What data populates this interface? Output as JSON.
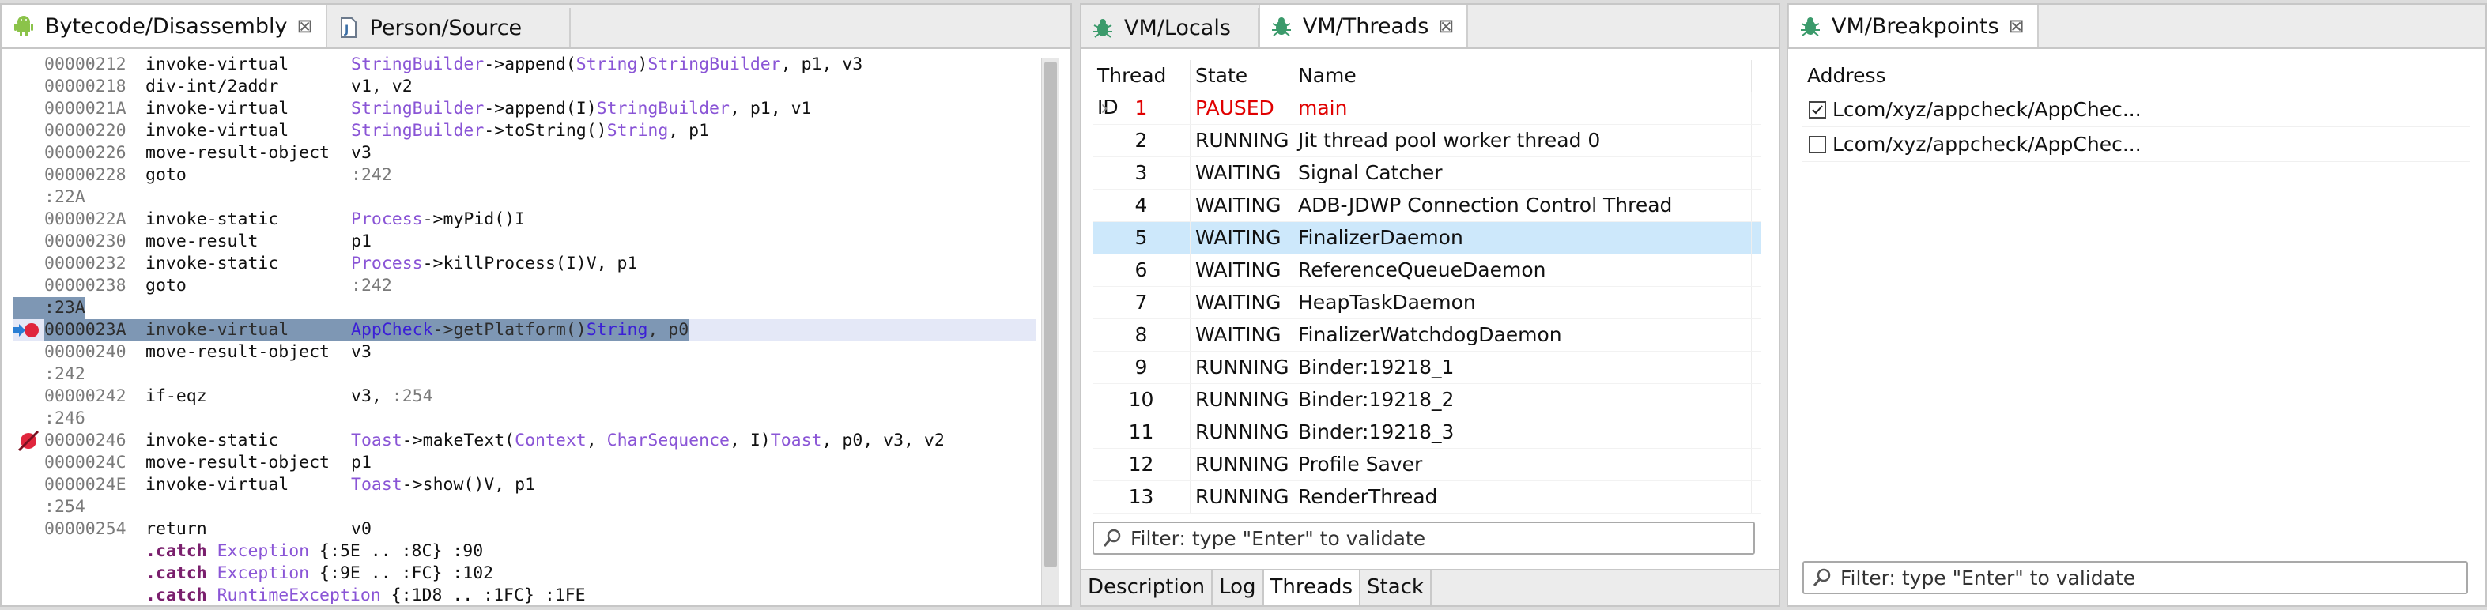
{
  "left_panel": {
    "tabs": [
      {
        "label": "Bytecode/Disassembly",
        "active": true
      },
      {
        "label": "Person/Source",
        "active": false
      }
    ],
    "code_lines": [
      {
        "type": "ins",
        "addr": "00000212",
        "op": "invoke-virtual",
        "args": [
          {
            "t": "StringBuilder",
            "c": "cls"
          },
          {
            "t": "->append(",
            "c": ""
          },
          {
            "t": "String",
            "c": "cls"
          },
          {
            "t": ")",
            "c": ""
          },
          {
            "t": "StringBuilder",
            "c": "cls"
          },
          {
            "t": ", p1, v3",
            "c": ""
          }
        ]
      },
      {
        "type": "ins",
        "addr": "00000218",
        "op": "div-int/2addr",
        "args": [
          {
            "t": "v1, v2",
            "c": ""
          }
        ]
      },
      {
        "type": "ins",
        "addr": "0000021A",
        "op": "invoke-virtual",
        "args": [
          {
            "t": "StringBuilder",
            "c": "cls"
          },
          {
            "t": "->append(I)",
            "c": ""
          },
          {
            "t": "StringBuilder",
            "c": "cls"
          },
          {
            "t": ", p1, v1",
            "c": ""
          }
        ]
      },
      {
        "type": "ins",
        "addr": "00000220",
        "op": "invoke-virtual",
        "args": [
          {
            "t": "StringBuilder",
            "c": "cls"
          },
          {
            "t": "->toString()",
            "c": ""
          },
          {
            "t": "String",
            "c": "cls"
          },
          {
            "t": ", p1",
            "c": ""
          }
        ]
      },
      {
        "type": "ins",
        "addr": "00000226",
        "op": "move-result-object",
        "args": [
          {
            "t": "v3",
            "c": ""
          }
        ]
      },
      {
        "type": "ins",
        "addr": "00000228",
        "op": "goto",
        "args": [
          {
            "t": ":242",
            "c": "dim"
          }
        ]
      },
      {
        "type": "label",
        "text": ":22A"
      },
      {
        "type": "ins",
        "addr": "0000022A",
        "op": "invoke-static",
        "args": [
          {
            "t": "Process",
            "c": "cls"
          },
          {
            "t": "->myPid()I",
            "c": ""
          }
        ]
      },
      {
        "type": "ins",
        "addr": "00000230",
        "op": "move-result",
        "args": [
          {
            "t": "p1",
            "c": ""
          }
        ]
      },
      {
        "type": "ins",
        "addr": "00000232",
        "op": "invoke-static",
        "args": [
          {
            "t": "Process",
            "c": "cls"
          },
          {
            "t": "->killProcess(I)V, p1",
            "c": ""
          }
        ]
      },
      {
        "type": "ins",
        "addr": "00000238",
        "op": "goto",
        "args": [
          {
            "t": ":242",
            "c": "dim"
          }
        ]
      },
      {
        "type": "label",
        "text": ":23A",
        "selected": true,
        "gutter": "arrow"
      },
      {
        "type": "ins",
        "addr": "0000023A",
        "op": "invoke-virtual",
        "highlight": true,
        "selected": true,
        "gutter": "breakpoint-arrow",
        "args": [
          {
            "t": "AppCheck",
            "c": "cls"
          },
          {
            "t": "->getPlatform()",
            "c": ""
          },
          {
            "t": "String",
            "c": "cls"
          },
          {
            "t": ", p0",
            "c": ""
          }
        ]
      },
      {
        "type": "ins",
        "addr": "00000240",
        "op": "move-result-object",
        "args": [
          {
            "t": "v3",
            "c": ""
          }
        ]
      },
      {
        "type": "label",
        "text": ":242"
      },
      {
        "type": "ins",
        "addr": "00000242",
        "op": "if-eqz",
        "args": [
          {
            "t": "v3, ",
            "c": ""
          },
          {
            "t": ":254",
            "c": "dim"
          }
        ]
      },
      {
        "type": "label",
        "text": ":246"
      },
      {
        "type": "ins",
        "addr": "00000246",
        "op": "invoke-static",
        "gutter": "breakpoint-disabled",
        "args": [
          {
            "t": "Toast",
            "c": "cls"
          },
          {
            "t": "->makeText(",
            "c": ""
          },
          {
            "t": "Context",
            "c": "cls"
          },
          {
            "t": ", ",
            "c": ""
          },
          {
            "t": "CharSequence",
            "c": "cls"
          },
          {
            "t": ", I)",
            "c": ""
          },
          {
            "t": "Toast",
            "c": "cls"
          },
          {
            "t": ", p0, v3, v2",
            "c": ""
          }
        ]
      },
      {
        "type": "ins",
        "addr": "0000024C",
        "op": "move-result-object",
        "args": [
          {
            "t": "p1",
            "c": ""
          }
        ]
      },
      {
        "type": "ins",
        "addr": "0000024E",
        "op": "invoke-virtual",
        "args": [
          {
            "t": "Toast",
            "c": "cls"
          },
          {
            "t": "->show()V, p1",
            "c": ""
          }
        ]
      },
      {
        "type": "label",
        "text": ":254"
      },
      {
        "type": "ins",
        "addr": "00000254",
        "op": "return",
        "args": [
          {
            "t": "v0",
            "c": ""
          }
        ]
      },
      {
        "type": "catch",
        "parts": [
          {
            "t": ".catch ",
            "c": "kw"
          },
          {
            "t": "Exception",
            "c": "cls"
          },
          {
            "t": " {:5E .. :8C} :90",
            "c": ""
          }
        ]
      },
      {
        "type": "catch",
        "parts": [
          {
            "t": ".catch ",
            "c": "kw"
          },
          {
            "t": "Exception",
            "c": "cls"
          },
          {
            "t": " {:9E .. :FC} :102",
            "c": ""
          }
        ]
      },
      {
        "type": "catch",
        "parts": [
          {
            "t": ".catch ",
            "c": "kw"
          },
          {
            "t": "RuntimeException",
            "c": "cls"
          },
          {
            "t": " {:1D8 .. :1FC} :1FE",
            "c": ""
          }
        ]
      }
    ]
  },
  "middle_panel": {
    "tabs": [
      {
        "label": "VM/Locals",
        "active": false
      },
      {
        "label": "VM/Threads",
        "active": true
      }
    ],
    "columns": [
      "Thread ID",
      "State",
      "Name"
    ],
    "rows": [
      {
        "id": "1",
        "state": "PAUSED",
        "name": "main",
        "paused": true,
        "expandable": true
      },
      {
        "id": "2",
        "state": "RUNNING",
        "name": "Jit thread pool worker thread 0"
      },
      {
        "id": "3",
        "state": "WAITING",
        "name": "Signal Catcher"
      },
      {
        "id": "4",
        "state": "WAITING",
        "name": "ADB-JDWP Connection Control Thread"
      },
      {
        "id": "5",
        "state": "WAITING",
        "name": "FinalizerDaemon",
        "selected": true
      },
      {
        "id": "6",
        "state": "WAITING",
        "name": "ReferenceQueueDaemon"
      },
      {
        "id": "7",
        "state": "WAITING",
        "name": "HeapTaskDaemon"
      },
      {
        "id": "8",
        "state": "WAITING",
        "name": "FinalizerWatchdogDaemon"
      },
      {
        "id": "9",
        "state": "RUNNING",
        "name": "Binder:19218_1"
      },
      {
        "id": "10",
        "state": "RUNNING",
        "name": "Binder:19218_2"
      },
      {
        "id": "11",
        "state": "RUNNING",
        "name": "Binder:19218_3"
      },
      {
        "id": "12",
        "state": "RUNNING",
        "name": "Profile Saver"
      },
      {
        "id": "13",
        "state": "RUNNING",
        "name": "RenderThread"
      }
    ],
    "filter_placeholder": "Filter: type \"Enter\" to validate",
    "bottom_tabs": [
      {
        "label": "Description",
        "active": false
      },
      {
        "label": "Log",
        "active": false
      },
      {
        "label": "Threads",
        "active": true
      },
      {
        "label": "Stack",
        "active": false
      }
    ]
  },
  "right_panel": {
    "tabs": [
      {
        "label": "VM/Breakpoints",
        "active": true
      }
    ],
    "column": "Address",
    "rows": [
      {
        "address": "Lcom/xyz/appcheck/AppChec...",
        "checked": true
      },
      {
        "address": "Lcom/xyz/appcheck/AppChec...",
        "checked": false
      }
    ],
    "filter_placeholder": "Filter: type \"Enter\" to validate"
  },
  "colors": {
    "class_name": "#8a55d6",
    "paused": "#e00000",
    "selection": "#cde8fb",
    "breakpoint": "#e0263d"
  }
}
